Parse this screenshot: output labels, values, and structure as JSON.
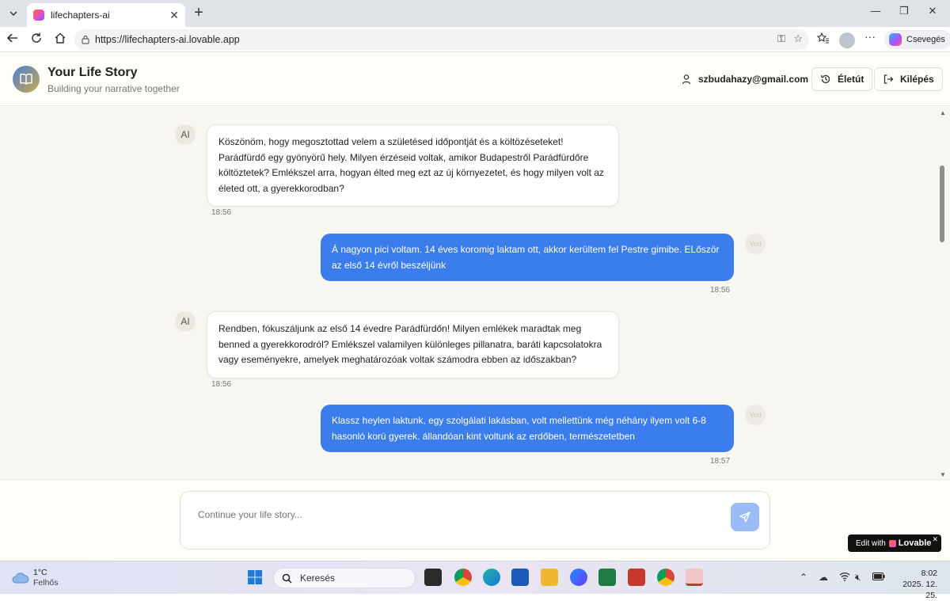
{
  "browser": {
    "tab_title": "lifechapters-ai",
    "url": "https://lifechapters-ai.lovable.app",
    "copilot_label": "Csevegés"
  },
  "header": {
    "title": "Your Life Story",
    "subtitle": "Building your narrative together",
    "user_email": "szbudahazy@gmail.com",
    "timeline_button": "Életút",
    "logout_button": "Kilépés"
  },
  "chat": {
    "ai_label": "AI",
    "you_label": "You",
    "messages": [
      {
        "role": "ai",
        "text": "Köszönöm, hogy megosztottad velem a születésed időpontját és a költözéseteket! Parádfürdő egy gyönyörű hely. Milyen érzéseid voltak, amikor Budapestről Parádfürdőre költöztetek? Emlékszel arra, hogyan élted meg ezt az új környezetet, és hogy milyen volt az életed ott, a gyerekkorodban?",
        "time": "18:56"
      },
      {
        "role": "you",
        "text": "Á nagyon pici voltam. 14 éves koromig laktam ott, akkor kerültem fel Pestre gimibe. ELőször az első 14 évről beszéljünk",
        "time": "18:56"
      },
      {
        "role": "ai",
        "text": "Rendben, fókuszáljunk az első 14 évedre Parádfürdőn! Milyen emlékek maradtak meg benned a gyerekkorodról? Emlékszel valamilyen különleges pillanatra, baráti kapcsolatokra vagy eseményekre, amelyek meghatározóak voltak számodra ebben az időszakban?",
        "time": "18:56"
      },
      {
        "role": "you",
        "text": "Klassz heylen laktunk, egy szolgálati lakásban, volt mellettünk még néhány ilyem volt 6-8 hasonló korú gyerek. állandóan kint voltunk az erdőben, természetetben",
        "time": "18:57"
      }
    ]
  },
  "composer": {
    "placeholder": "Continue your life story..."
  },
  "badge": {
    "edit_with": "Edit with",
    "brand": "Lovable"
  },
  "taskbar": {
    "temperature": "1°C",
    "weather": "Felhős",
    "search_label": "Keresés",
    "time": "8:02",
    "date": "2025. 12. 25."
  }
}
